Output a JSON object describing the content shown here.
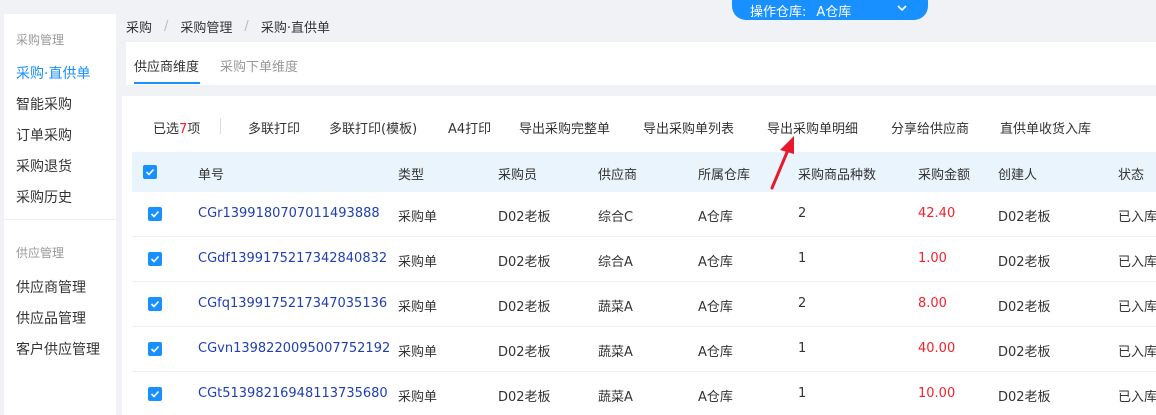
{
  "warehouse": {
    "label": "操作仓库:",
    "value": "A仓库"
  },
  "breadcrumb": [
    "采购",
    "采购管理",
    "采购·直供单"
  ],
  "sidebar": {
    "groups": [
      {
        "title": "采购管理",
        "items": [
          {
            "label": "采购·直供单",
            "active": true
          },
          {
            "label": "智能采购"
          },
          {
            "label": "订单采购"
          },
          {
            "label": "采购退货"
          },
          {
            "label": "采购历史"
          }
        ]
      },
      {
        "title": "供应管理",
        "items": [
          {
            "label": "供应商管理"
          },
          {
            "label": "供应品管理"
          },
          {
            "label": "客户供应管理"
          }
        ]
      }
    ]
  },
  "tabs": [
    {
      "label": "供应商维度",
      "active": true
    },
    {
      "label": "采购下单维度"
    }
  ],
  "toolbar": {
    "selected_prefix": "已选",
    "selected_count": "7",
    "selected_suffix": "项",
    "actions": [
      "多联打印",
      "多联打印(模板)",
      "A4打印",
      "导出采购完整单",
      "导出采购单列表",
      "导出采购单明细",
      "分享给供应商",
      "直供单收货入库"
    ]
  },
  "table": {
    "columns": [
      "单号",
      "类型",
      "采购员",
      "供应商",
      "所属仓库",
      "采购商品种数",
      "采购金额",
      "创建人",
      "状态"
    ],
    "rows": [
      {
        "no": "CGr1399180707011493888",
        "type": "采购单",
        "buyer": "D02老板",
        "supplier": "综合C",
        "warehouse": "A仓库",
        "kinds": "2",
        "amount": "42.40",
        "creator": "D02老板",
        "status": "已入库"
      },
      {
        "no": "CGdf1399175217342840832",
        "type": "采购单",
        "buyer": "D02老板",
        "supplier": "综合A",
        "warehouse": "A仓库",
        "kinds": "1",
        "amount": "1.00",
        "creator": "D02老板",
        "status": "已入库"
      },
      {
        "no": "CGfq1399175217347035136",
        "type": "采购单",
        "buyer": "D02老板",
        "supplier": "蔬菜A",
        "warehouse": "A仓库",
        "kinds": "2",
        "amount": "8.00",
        "creator": "D02老板",
        "status": "已入库"
      },
      {
        "no": "CGvn1398220095007752192",
        "type": "采购单",
        "buyer": "D02老板",
        "supplier": "蔬菜A",
        "warehouse": "A仓库",
        "kinds": "1",
        "amount": "40.00",
        "creator": "D02老板",
        "status": "已入库"
      },
      {
        "no": "CGt51398216948113735680",
        "type": "采购单",
        "buyer": "D02老板",
        "supplier": "蔬菜A",
        "warehouse": "A仓库",
        "kinds": "1",
        "amount": "10.00",
        "creator": "D02老板",
        "status": "已入库"
      }
    ]
  },
  "colors": {
    "accent": "#1890ff",
    "amount": "#f5222d",
    "link": "#1f3fb3",
    "header_bg": "#e9f4fd",
    "annotation": "#e8192c"
  }
}
